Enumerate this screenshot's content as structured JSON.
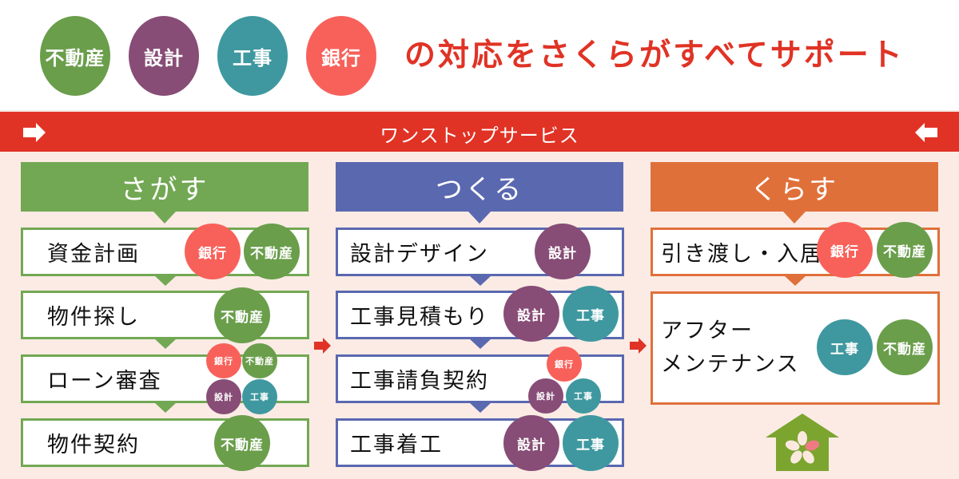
{
  "header": {
    "badges": [
      {
        "label": "不動産",
        "category": "realestate",
        "color": "#6a9e4b"
      },
      {
        "label": "設計",
        "category": "design",
        "color": "#874d76"
      },
      {
        "label": "工事",
        "category": "construction",
        "color": "#3f989f"
      },
      {
        "label": "銀行",
        "category": "bank",
        "color": "#f8615a"
      }
    ],
    "headline": "の対応をさくらがすべてサポート",
    "headline_color": "#e03325"
  },
  "banner": {
    "title": "ワンストップサービス",
    "color": "#e03325",
    "left_icon": "arrow-right-icon",
    "right_icon": "arrow-left-icon"
  },
  "columns": [
    {
      "title": "さがす",
      "color": "#72a853",
      "steps": [
        {
          "label": "資金計画",
          "badges": [
            "銀行",
            "不動産"
          ]
        },
        {
          "label": "物件探し",
          "badges": [
            "不動産"
          ]
        },
        {
          "label": "ローン審査",
          "badges": [
            "銀行",
            "不動産",
            "設計",
            "工事"
          ]
        },
        {
          "label": "物件契約",
          "badges": [
            "不動産"
          ]
        }
      ]
    },
    {
      "title": "つくる",
      "color": "#5a68b0",
      "steps": [
        {
          "label": "設計デザイン",
          "badges": [
            "設計"
          ]
        },
        {
          "label": "工事見積もり",
          "badges": [
            "設計",
            "工事"
          ]
        },
        {
          "label": "工事請負契約",
          "badges": [
            "銀行",
            "設計",
            "工事"
          ]
        },
        {
          "label": "工事着工",
          "badges": [
            "設計",
            "工事"
          ]
        }
      ]
    },
    {
      "title": "くらす",
      "color": "#e0703a",
      "steps": [
        {
          "label": "引き渡し・入居",
          "badges": [
            "銀行",
            "不動産"
          ]
        },
        {
          "label_line1": "アフター",
          "label_line2": "メンテナンス",
          "badges": [
            "工事",
            "不動産"
          ]
        }
      ]
    }
  ],
  "footer_icon": "sakura-house-icon"
}
